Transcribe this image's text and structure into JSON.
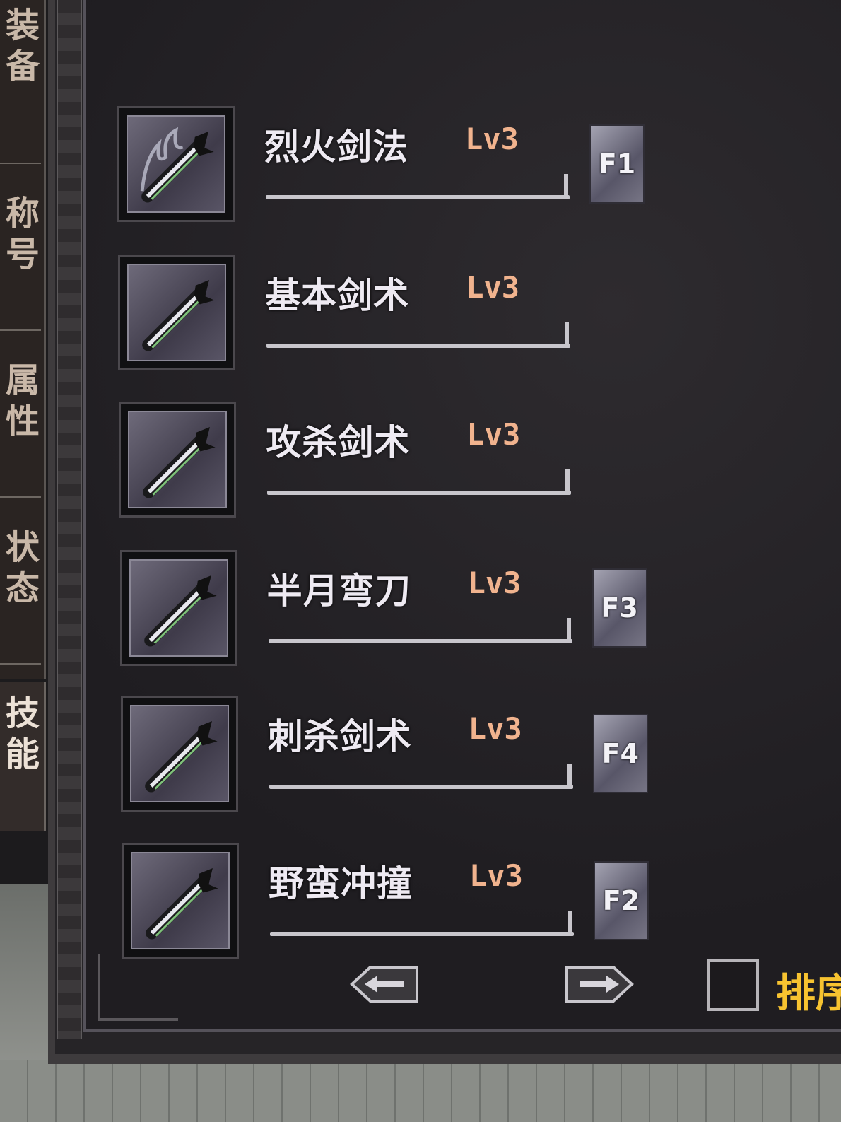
{
  "tabs": [
    {
      "label": "装备"
    },
    {
      "label": "称号"
    },
    {
      "label": "属性"
    },
    {
      "label": "状态"
    }
  ],
  "skill_tab": {
    "label": "技能"
  },
  "skills": [
    {
      "name": "烈火剑法",
      "level": "Lv3",
      "hotkey": "F1",
      "icon": "flaming-sword-icon"
    },
    {
      "name": "基本剑术",
      "level": "Lv3",
      "hotkey": "",
      "icon": "sword-icon"
    },
    {
      "name": "攻杀剑术",
      "level": "Lv3",
      "hotkey": "",
      "icon": "sword-icon"
    },
    {
      "name": "半月弯刀",
      "level": "Lv3",
      "hotkey": "F3",
      "icon": "crescent-sword-icon"
    },
    {
      "name": "刺杀剑术",
      "level": "Lv3",
      "hotkey": "F4",
      "icon": "sword-icon"
    },
    {
      "name": "野蛮冲撞",
      "level": "Lv3",
      "hotkey": "F2",
      "icon": "sword-icon"
    }
  ],
  "footer": {
    "prev_icon": "left-arrow-icon",
    "next_icon": "right-arrow-icon",
    "sort_label": "排序"
  },
  "colors": {
    "level_text": "#f1b38e",
    "sort_text": "#f7c330",
    "skill_text": "#eeeaf2"
  }
}
